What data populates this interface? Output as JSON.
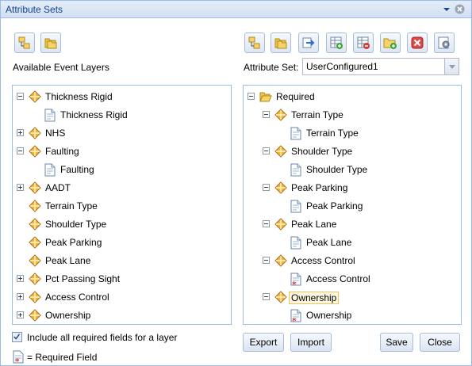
{
  "window": {
    "title": "Attribute Sets"
  },
  "left": {
    "label": "Available Event Layers",
    "tree": [
      {
        "label": "Thickness Rigid",
        "expander": "minus",
        "icon": "layer"
      },
      {
        "label": "Thickness Rigid",
        "expander": "none",
        "icon": "field"
      },
      {
        "label": "NHS",
        "expander": "plus",
        "icon": "layer"
      },
      {
        "label": "Faulting",
        "expander": "minus",
        "icon": "layer"
      },
      {
        "label": "Faulting",
        "expander": "none",
        "icon": "field"
      },
      {
        "label": "AADT",
        "expander": "plus",
        "icon": "layer"
      },
      {
        "label": "Terrain Type",
        "expander": "none",
        "icon": "layer"
      },
      {
        "label": "Shoulder Type",
        "expander": "none",
        "icon": "layer"
      },
      {
        "label": "Peak Parking",
        "expander": "none",
        "icon": "layer"
      },
      {
        "label": "Peak Lane",
        "expander": "none",
        "icon": "layer"
      },
      {
        "label": "Pct Passing Sight",
        "expander": "plus",
        "icon": "layer"
      },
      {
        "label": "Access Control",
        "expander": "plus",
        "icon": "layer"
      },
      {
        "label": "Ownership",
        "expander": "plus",
        "icon": "layer"
      }
    ]
  },
  "right": {
    "attribute_set_label": "Attribute Set:",
    "attribute_set_value": "UserConfigured1",
    "tree": [
      {
        "label": "Required",
        "expander": "minus",
        "icon": "folder-open"
      },
      {
        "label": "Terrain Type",
        "expander": "minus",
        "icon": "layer"
      },
      {
        "label": "Terrain Type",
        "expander": "none",
        "icon": "field"
      },
      {
        "label": "Shoulder Type",
        "expander": "minus",
        "icon": "layer"
      },
      {
        "label": "Shoulder Type",
        "expander": "none",
        "icon": "field"
      },
      {
        "label": "Peak Parking",
        "expander": "minus",
        "icon": "layer"
      },
      {
        "label": "Peak Parking",
        "expander": "none",
        "icon": "field"
      },
      {
        "label": "Peak Lane",
        "expander": "minus",
        "icon": "layer"
      },
      {
        "label": "Peak Lane",
        "expander": "none",
        "icon": "field"
      },
      {
        "label": "Access Control",
        "expander": "minus",
        "icon": "layer"
      },
      {
        "label": "Access Control",
        "expander": "none",
        "icon": "required-field"
      },
      {
        "label": "Ownership",
        "expander": "minus",
        "icon": "layer",
        "selected": true
      },
      {
        "label": "Ownership",
        "expander": "none",
        "icon": "required-field"
      }
    ]
  },
  "footer": {
    "include_required_label": "Include all required fields for a layer",
    "include_required_checked": true,
    "legend_label": "= Required Field",
    "export_label": "Export",
    "import_label": "Import",
    "save_label": "Save",
    "close_label": "Close"
  },
  "colors": {
    "title_text": "#15428b",
    "panel_border": "#99bbe8",
    "required_star": "#dd0000"
  }
}
